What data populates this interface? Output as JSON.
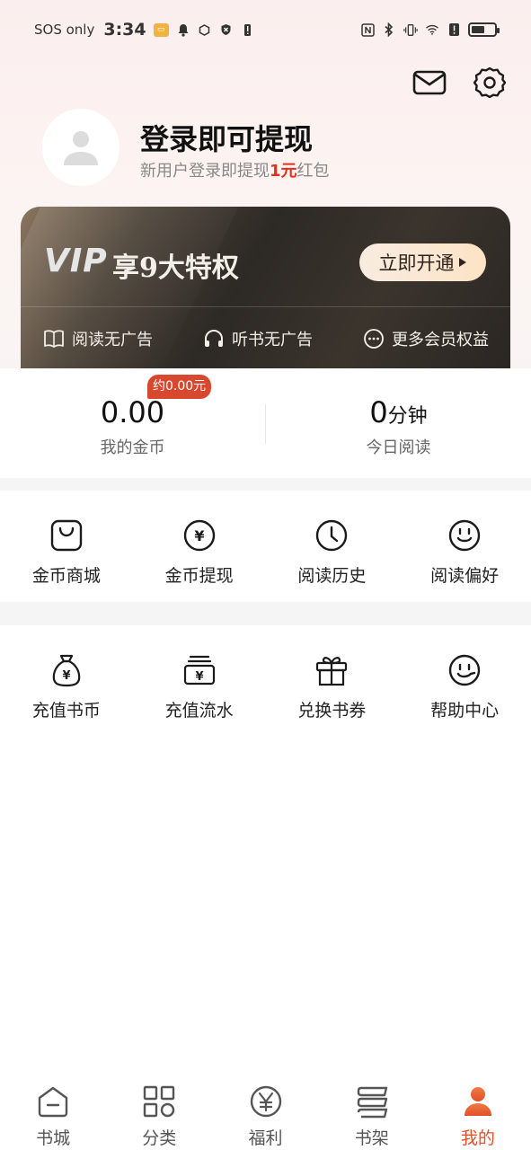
{
  "status_bar": {
    "carrier": "SOS only",
    "time": "3:34"
  },
  "header": {
    "mail_icon": "mail-icon",
    "settings_icon": "gear-icon"
  },
  "profile": {
    "title": "登录即可提现",
    "subtitle_prefix": "新用户登录即提现",
    "subtitle_amount": "1元",
    "subtitle_suffix": "红包"
  },
  "vip": {
    "logo": "VIP",
    "title": "享9大特权",
    "open_button": "立即开通",
    "benefits": [
      {
        "label": "阅读无广告",
        "icon": "book-icon"
      },
      {
        "label": "听书无广告",
        "icon": "headphones-icon"
      },
      {
        "label": "更多会员权益",
        "icon": "more-icon"
      }
    ]
  },
  "stats": {
    "coins_value": "0.00",
    "coins_label": "我的金币",
    "coins_badge": "约0.00元",
    "reading_value": "0",
    "reading_unit": "分钟",
    "reading_label": "今日阅读"
  },
  "grid1": [
    {
      "label": "金币商城",
      "icon": "shopping-bag-icon"
    },
    {
      "label": "金币提现",
      "icon": "yen-coin-icon"
    },
    {
      "label": "阅读历史",
      "icon": "clock-icon"
    },
    {
      "label": "阅读偏好",
      "icon": "smiley-icon"
    }
  ],
  "grid2": [
    {
      "label": "充值书币",
      "icon": "money-bag-icon"
    },
    {
      "label": "充值流水",
      "icon": "wallet-yen-icon"
    },
    {
      "label": "兑换书券",
      "icon": "gift-icon"
    },
    {
      "label": "帮助中心",
      "icon": "support-icon"
    }
  ],
  "bottom_nav": [
    {
      "label": "书城",
      "icon": "home-icon",
      "active": false
    },
    {
      "label": "分类",
      "icon": "category-icon",
      "active": false
    },
    {
      "label": "福利",
      "icon": "yen-circle-icon",
      "active": false
    },
    {
      "label": "书架",
      "icon": "bookshelf-icon",
      "active": false
    },
    {
      "label": "我的",
      "icon": "person-icon",
      "active": true
    }
  ],
  "colors": {
    "accent": "#e0502a",
    "badge": "#d8482e",
    "vip_dark": "#2d2925"
  }
}
